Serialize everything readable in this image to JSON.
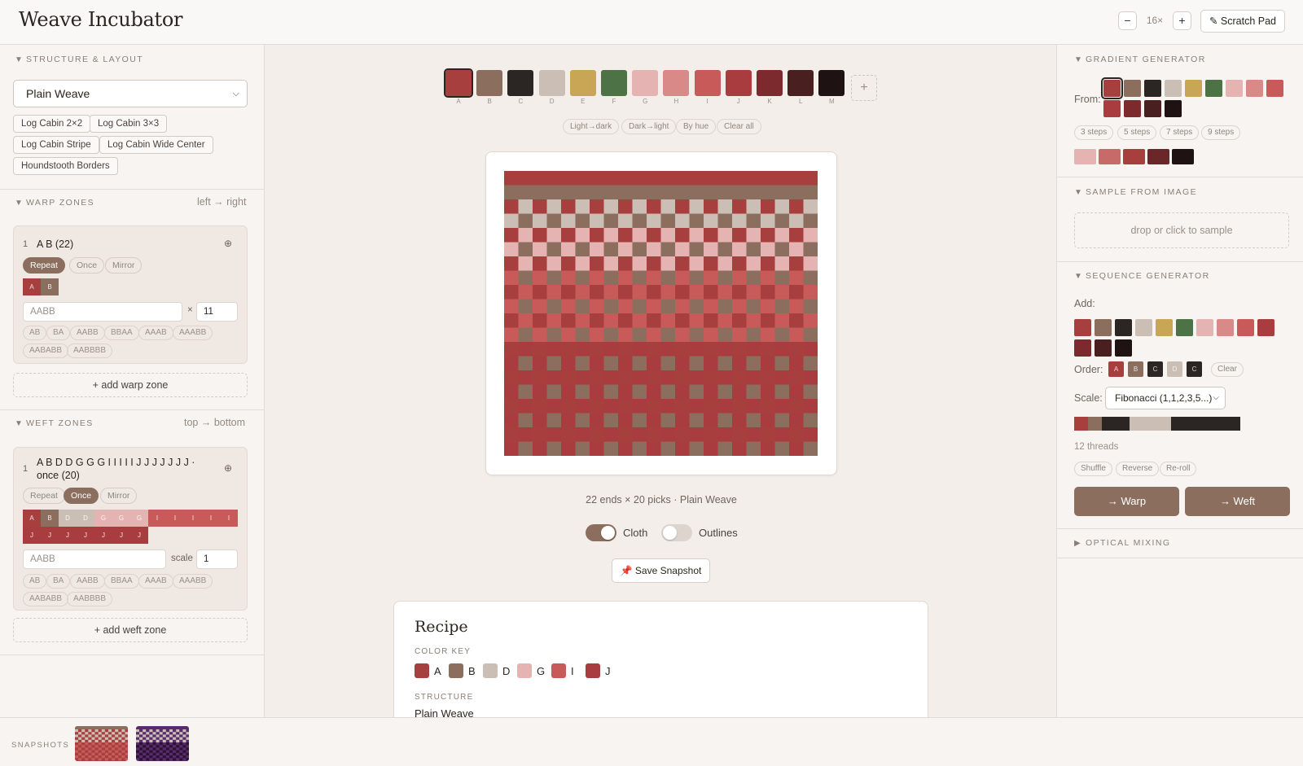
{
  "header": {
    "title": "Weave Incubator",
    "zoom_minus": "−",
    "zoom_level": "16×",
    "zoom_plus": "+",
    "scratch_pad": "✎ Scratch Pad"
  },
  "colors": {
    "A": "#a83f3f",
    "B": "#8b6e5e",
    "C": "#2b2623",
    "D": "#cbbfb5",
    "E": "#c8a655",
    "F": "#4c7246",
    "G": "#e5b3b1",
    "H": "#d98a88",
    "I": "#c95a5a",
    "J": "#a83c3e",
    "K": "#7c2a2d",
    "L": "#4a1f1f",
    "M": "#1e1213",
    "accent": "#8b6e5e"
  },
  "left": {
    "structure": {
      "heading": "STRUCTURE & LAYOUT",
      "selected": "Plain Weave",
      "presets": [
        "Log Cabin 2×2",
        "Log Cabin 3×3",
        "Log Cabin Stripe",
        "Log Cabin Wide Center",
        "Houndstooth Borders"
      ]
    },
    "warp": {
      "heading": "WARP ZONES",
      "direction": "left → right",
      "zone": {
        "num": "1",
        "text": "A B (22)",
        "modes": [
          "Repeat",
          "Once",
          "Mirror"
        ],
        "active_mode": "Repeat",
        "cells": [
          "A",
          "B"
        ],
        "pattern_placeholder": "AABB",
        "times": "×",
        "count": "11",
        "suggestions": [
          "AB",
          "BA",
          "AABB",
          "BBAA",
          "AAAB",
          "AAABB",
          "AABABB",
          "AABBBB"
        ]
      },
      "add": "+ add warp zone"
    },
    "weft": {
      "heading": "WEFT ZONES",
      "direction": "top → bottom",
      "zone": {
        "num": "1",
        "text_line1": "A B D D G G G I I I I I J J J J J J J ·",
        "text_line2": "once (20)",
        "modes": [
          "Repeat",
          "Once",
          "Mirror"
        ],
        "active_mode": "Once",
        "cells": [
          "A",
          "B",
          "D",
          "D",
          "G",
          "G",
          "G",
          "I",
          "I",
          "I",
          "I",
          "I",
          "J",
          "J",
          "J",
          "J",
          "J",
          "J",
          "J"
        ],
        "pattern_placeholder": "AABB",
        "scale_label": "scale",
        "scale": "1",
        "suggestions": [
          "AB",
          "BA",
          "AABB",
          "BBAA",
          "AAAB",
          "AAABB",
          "AABABB",
          "AABBBB"
        ]
      },
      "add": "+ add weft zone"
    }
  },
  "center": {
    "palette_letters": [
      "A",
      "B",
      "C",
      "D",
      "E",
      "F",
      "G",
      "H",
      "I",
      "J",
      "K",
      "L",
      "M"
    ],
    "palette_add": "+",
    "sort_options": [
      "Light→dark",
      "Dark→light",
      "By hue",
      "Clear all"
    ],
    "cloth": {
      "warp": [
        "A",
        "B",
        "A",
        "B",
        "A",
        "B",
        "A",
        "B",
        "A",
        "B",
        "A",
        "B",
        "A",
        "B",
        "A",
        "B",
        "A",
        "B",
        "A",
        "B",
        "A",
        "B"
      ],
      "weft": [
        "A",
        "B",
        "D",
        "D",
        "G",
        "G",
        "G",
        "I",
        "I",
        "I",
        "I",
        "I",
        "J",
        "J",
        "J",
        "J",
        "J",
        "J",
        "J",
        "J"
      ]
    },
    "caption": "22 ends × 20 picks · Plain Weave",
    "toggles": {
      "cloth_label": "Cloth",
      "cloth_on": true,
      "outlines_label": "Outlines",
      "outlines_on": false
    },
    "snapshot_button": "📌 Save Snapshot",
    "recipe": {
      "title": "Recipe",
      "color_key_label": "COLOR KEY",
      "key": [
        "A",
        "B",
        "D",
        "G",
        "I",
        "J"
      ],
      "structure_label": "STRUCTURE",
      "structure_value": "Plain Weave"
    }
  },
  "right": {
    "gradient": {
      "heading": "GRADIENT GENERATOR",
      "from_label": "From:",
      "selected": "A",
      "steps": [
        "3 steps",
        "5 steps",
        "7 steps",
        "9 steps"
      ],
      "result": [
        "#e5b3b1",
        "#c96a6a",
        "#a83f3f",
        "#6b2629",
        "#1e1213"
      ]
    },
    "sample": {
      "heading": "SAMPLE FROM IMAGE",
      "drop": "drop or click to sample"
    },
    "sequence": {
      "heading": "SEQUENCE GENERATOR",
      "add_label": "Add:",
      "order_label": "Order:",
      "order": [
        "A",
        "B",
        "C",
        "D",
        "C"
      ],
      "clear": "Clear",
      "scale_label": "Scale:",
      "scale_value": "Fibonacci (1,1,2,3,5...)",
      "bar": [
        {
          "c": "A",
          "n": 1
        },
        {
          "c": "B",
          "n": 1
        },
        {
          "c": "C",
          "n": 2
        },
        {
          "c": "D",
          "n": 3
        },
        {
          "c": "C",
          "n": 5
        }
      ],
      "threads": "12 threads",
      "actions": [
        "Shuffle",
        "Reverse",
        "Re-roll"
      ],
      "to_warp": "→ Warp",
      "to_weft": "→ Weft"
    },
    "optical": {
      "heading": "OPTICAL MIXING"
    }
  },
  "snapshots": {
    "label": "SNAPSHOTS",
    "count": 2
  }
}
